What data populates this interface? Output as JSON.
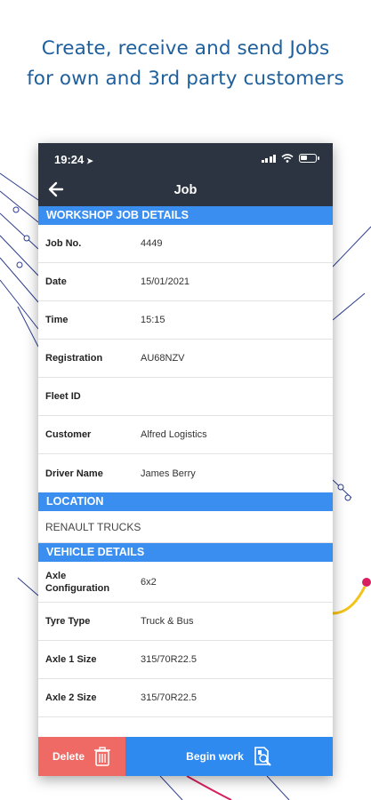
{
  "headline": {
    "line1": "Create, receive and send Jobs",
    "line2": "for own and 3rd party customers"
  },
  "status_bar": {
    "time": "19:24"
  },
  "nav": {
    "title": "Job",
    "back_icon": "arrow-left-icon"
  },
  "sections": {
    "workshop": {
      "title": "WORKSHOP JOB DETAILS",
      "rows": [
        {
          "label": "Job No.",
          "value": "4449"
        },
        {
          "label": "Date",
          "value": "15/01/2021"
        },
        {
          "label": "Time",
          "value": "15:15"
        },
        {
          "label": "Registration",
          "value": "AU68NZV"
        },
        {
          "label": "Fleet ID",
          "value": ""
        },
        {
          "label": "Customer",
          "value": "Alfred Logistics"
        },
        {
          "label": "Driver Name",
          "value": "James Berry"
        }
      ]
    },
    "location": {
      "title": "LOCATION",
      "value": "RENAULT TRUCKS"
    },
    "vehicle": {
      "title": "VEHICLE DETAILS",
      "rows": [
        {
          "label_line1": "Axle",
          "label_line2": "Configuration",
          "value": "6x2"
        },
        {
          "label": "Tyre Type",
          "value": "Truck & Bus"
        },
        {
          "label": "Axle 1 Size",
          "value": "315/70R22.5"
        },
        {
          "label": "Axle 2 Size",
          "value": "315/70R22.5"
        }
      ]
    }
  },
  "footer": {
    "delete_label": "Delete",
    "delete_icon": "trash-icon",
    "begin_label": "Begin work",
    "begin_icon": "document-search-icon"
  },
  "colors": {
    "headline": "#1e5f9c",
    "bar_dark": "#2b3440",
    "section_blue": "#3a8ef0",
    "delete_red": "#ef6a65",
    "begin_blue": "#2f8af0"
  }
}
